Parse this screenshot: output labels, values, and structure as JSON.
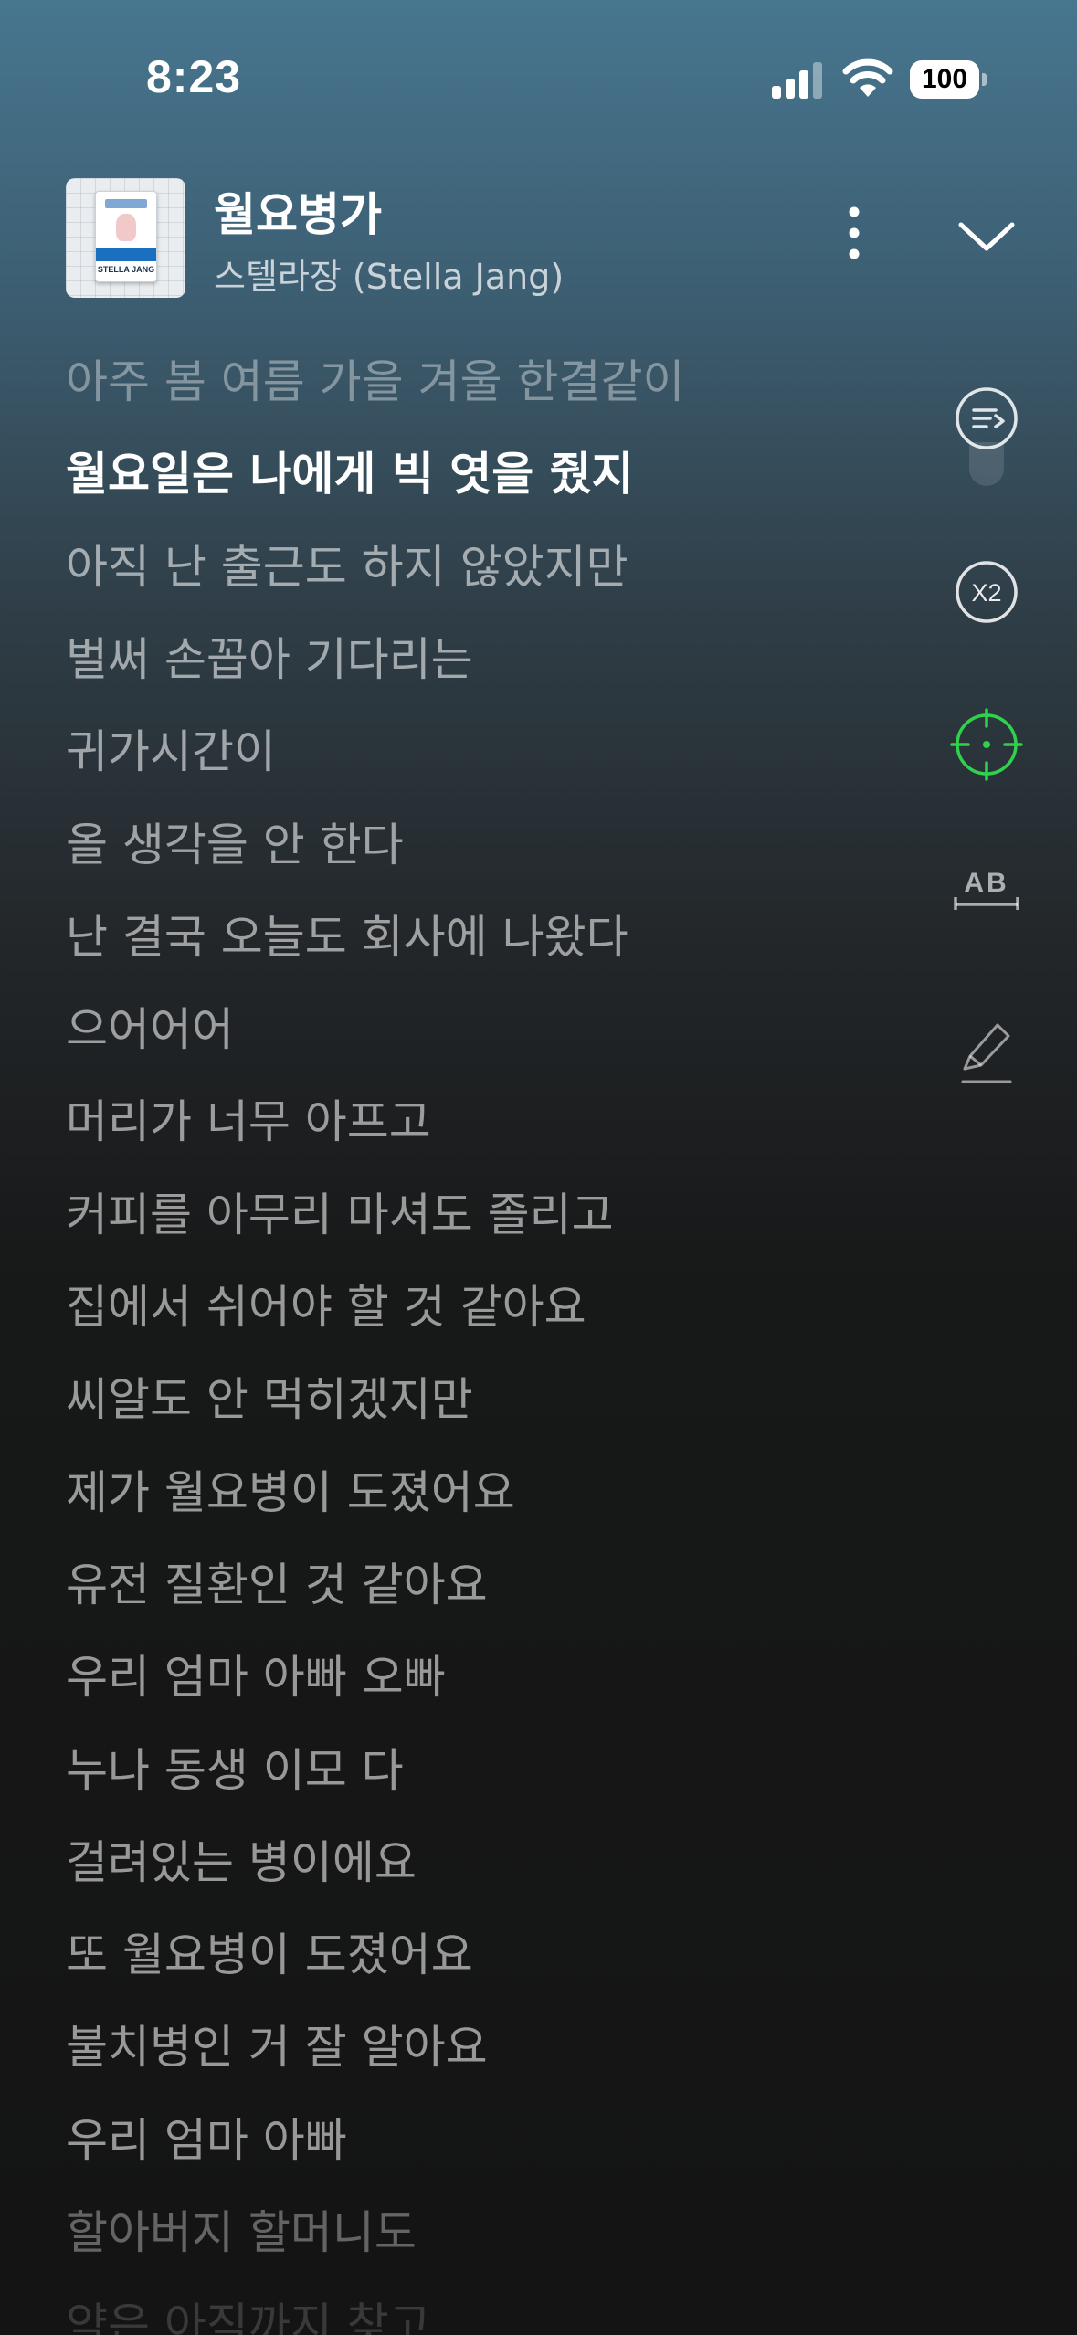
{
  "status_bar": {
    "time": "8:23",
    "battery": "100",
    "icons": [
      "signal-icon",
      "wifi-icon",
      "battery-icon"
    ]
  },
  "header": {
    "title": "월요병가",
    "artist": "스텔라장 (Stella Jang)",
    "album_art_text": "STELLA JANG",
    "more_icon": "more-vertical-icon",
    "collapse_icon": "chevron-down-icon"
  },
  "lyrics": {
    "current_index": 1,
    "lines": [
      "아주 봄 여름 가을 겨울 한결같이",
      "월요일은 나에게 빅 엿을 줬지",
      "아직 난 출근도 하지 않았지만",
      "벌써 손꼽아 기다리는",
      "귀가시간이",
      "올 생각을 안 한다",
      "난 결국 오늘도 회사에 나왔다",
      "으어어어",
      "머리가 너무 아프고",
      "커피를 아무리 마셔도 졸리고",
      "집에서 쉬어야 할 것 같아요",
      "씨알도 안 먹히겠지만",
      "제가 월요병이 도졌어요",
      "유전 질환인 것 같아요",
      "우리 엄마 아빠 오빠",
      "누나 동생 이모 다",
      "걸려있는 병이에요",
      "또 월요병이 도졌어요",
      "불치병인 거 잘 알아요",
      "우리 엄마 아빠",
      "할아버지 할머니도",
      "약은 아직까지 찾고"
    ]
  },
  "tools": {
    "queue_icon": "queue-list-icon",
    "speed_label": "X2",
    "locate_icon": "crosshair-icon",
    "translate_label": "AB",
    "highlight_icon": "highlighter-pen-icon",
    "accent_color": "#2fd24a"
  }
}
